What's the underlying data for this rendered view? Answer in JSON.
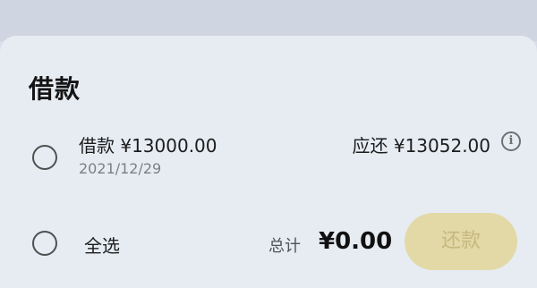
{
  "section": {
    "title": "借款"
  },
  "loan_item": {
    "label": "借款 ¥13000.00",
    "date": "2021/12/29",
    "due_text": "应还 ¥13052.00"
  },
  "footer": {
    "select_all_label": "全选",
    "total_label": "总计",
    "total_value": "¥0.00",
    "repay_label": "还款"
  },
  "icons": {
    "info": "info-icon"
  },
  "colors": {
    "button_bg": "#e2d9a6",
    "button_text": "#c6b87f"
  }
}
